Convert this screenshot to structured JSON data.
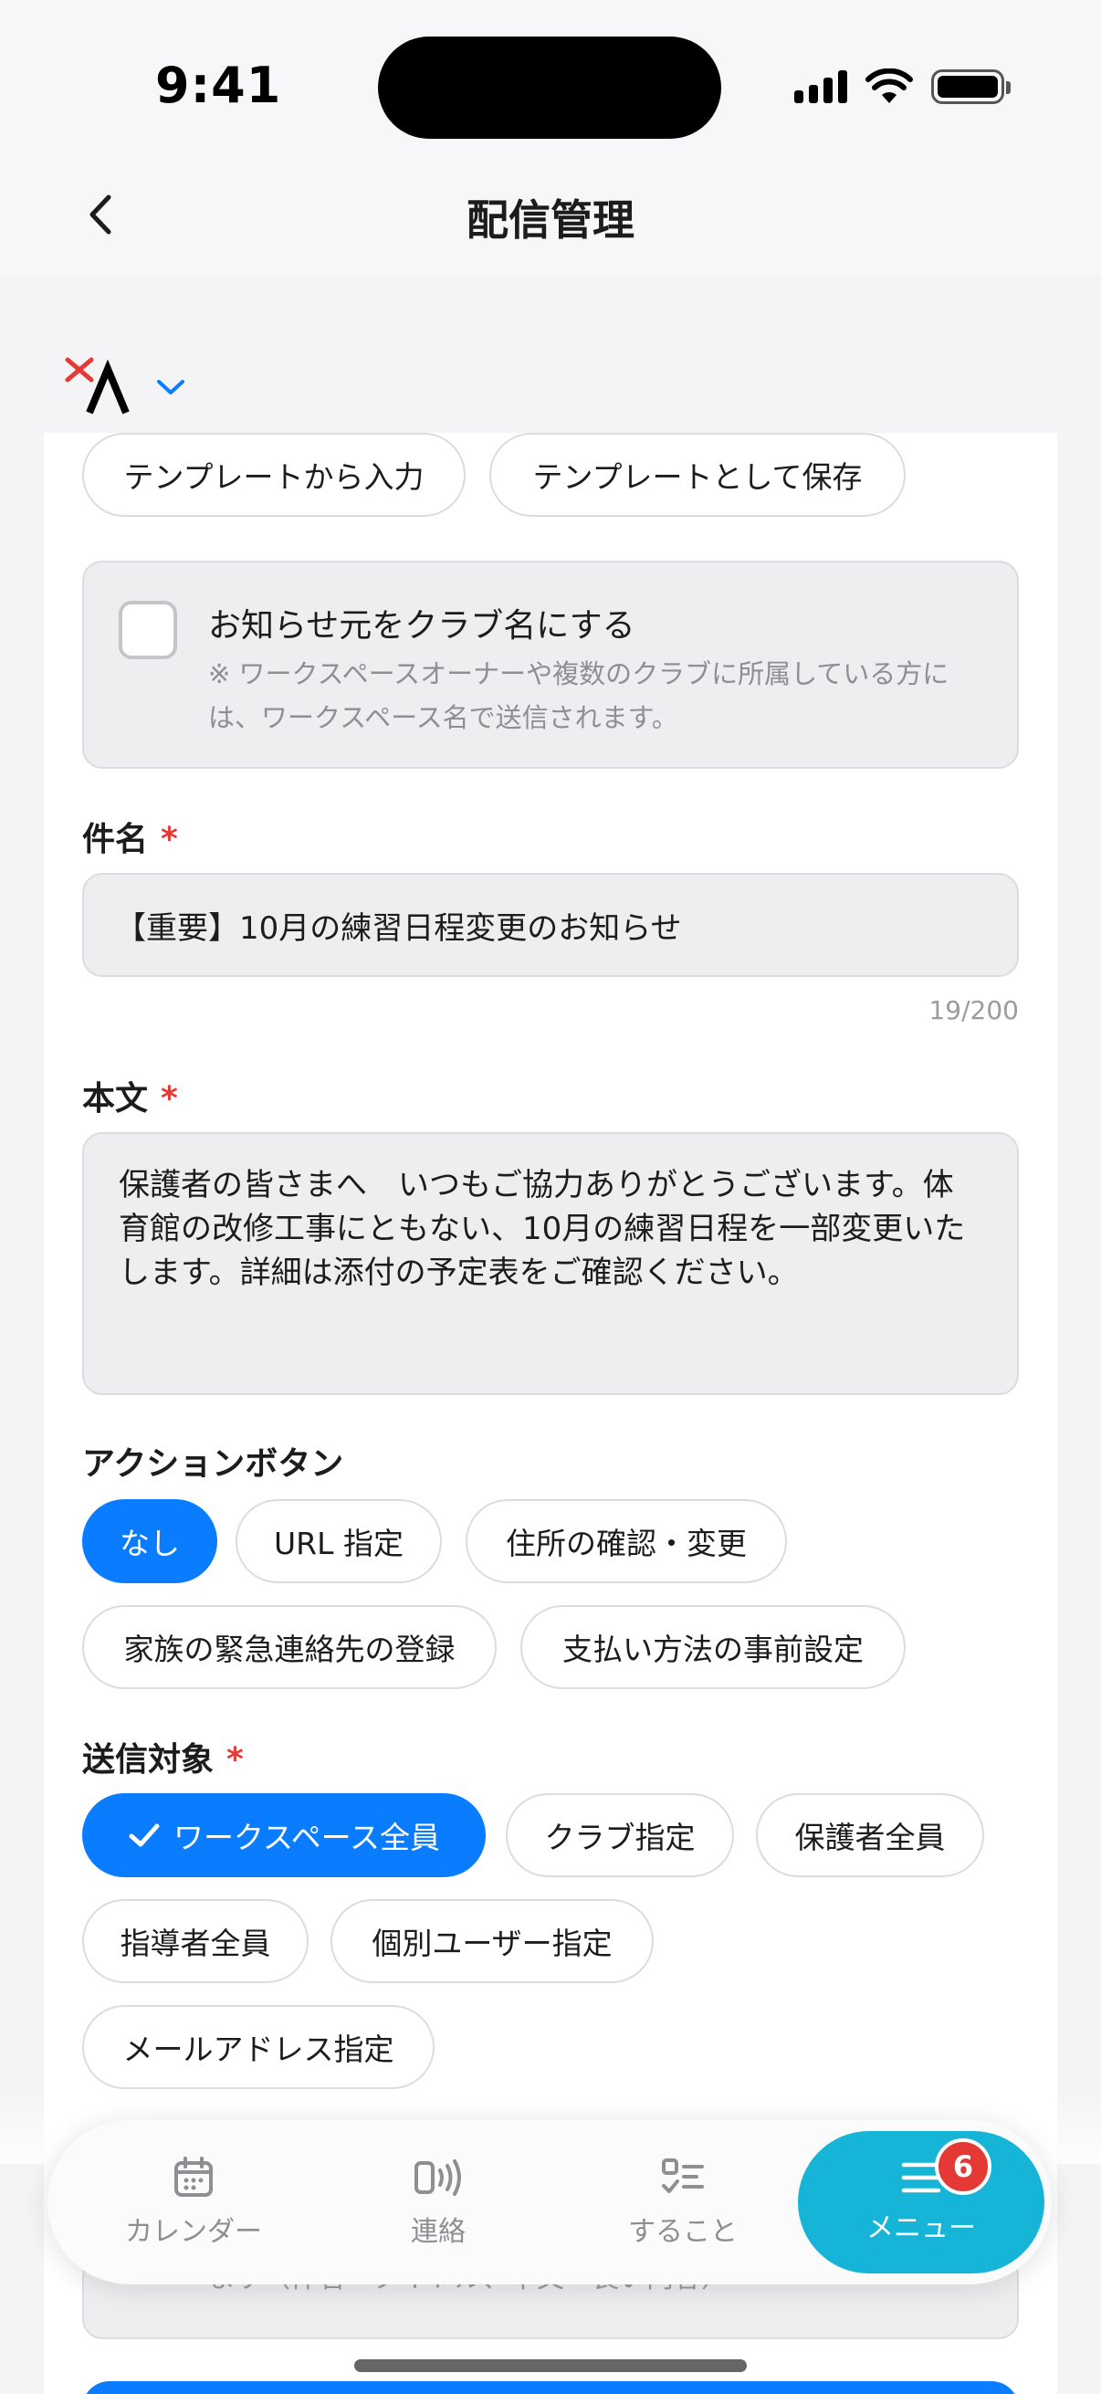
{
  "status_bar": {
    "time": "9:41"
  },
  "header": {
    "title": "配信管理"
  },
  "template_buttons": {
    "input_from_template": "テンプレートから入力",
    "save_as_template": "テンプレートとして保存"
  },
  "notice_option": {
    "checked": false,
    "label": "お知らせ元をクラブ名にする",
    "note": "※ ワークスペースオーナーや複数のクラブに所属している方には、ワークスペース名で送信されます。"
  },
  "subject": {
    "label": "件名",
    "required_mark": "*",
    "value": "【重要】10月の練習日程変更のお知らせ",
    "counter": "19/200"
  },
  "body": {
    "label": "本文",
    "required_mark": "*",
    "value": "保護者の皆さまへ　いつもご協力ありがとうございます。体育館の改修工事にともない、10月の練習日程を一部変更いたします。詳細は添付の予定表をご確認ください。"
  },
  "action_button": {
    "label": "アクションボタン",
    "options": [
      "なし",
      "URL 指定",
      "住所の確認・変更",
      "家族の緊急連絡先の登録",
      "支払い方法の事前設定"
    ],
    "selected": "なし"
  },
  "recipients": {
    "label": "送信対象",
    "required_mark": "*",
    "options": [
      "ワークスペース全員",
      "クラブ指定",
      "保護者全員",
      "指導者全員",
      "個別ユーザー指定",
      "メールアドレス指定"
    ],
    "selected": "ワークスペース全員"
  },
  "peek_hint": "ます（件名＝タイトル、本文＝長い内容）",
  "tab_bar": {
    "items": [
      {
        "label": "カレンダー",
        "icon": "calendar-icon"
      },
      {
        "label": "連絡",
        "icon": "broadcast-icon"
      },
      {
        "label": "すること",
        "icon": "checklist-icon"
      },
      {
        "label": "メニュー",
        "icon": "menu-icon",
        "badge": "6"
      }
    ],
    "active": "メニュー"
  },
  "colors": {
    "accent": "#0a7cff",
    "active_tab": "#16b4d6",
    "required": "#e53935",
    "badge": "#e53935"
  }
}
